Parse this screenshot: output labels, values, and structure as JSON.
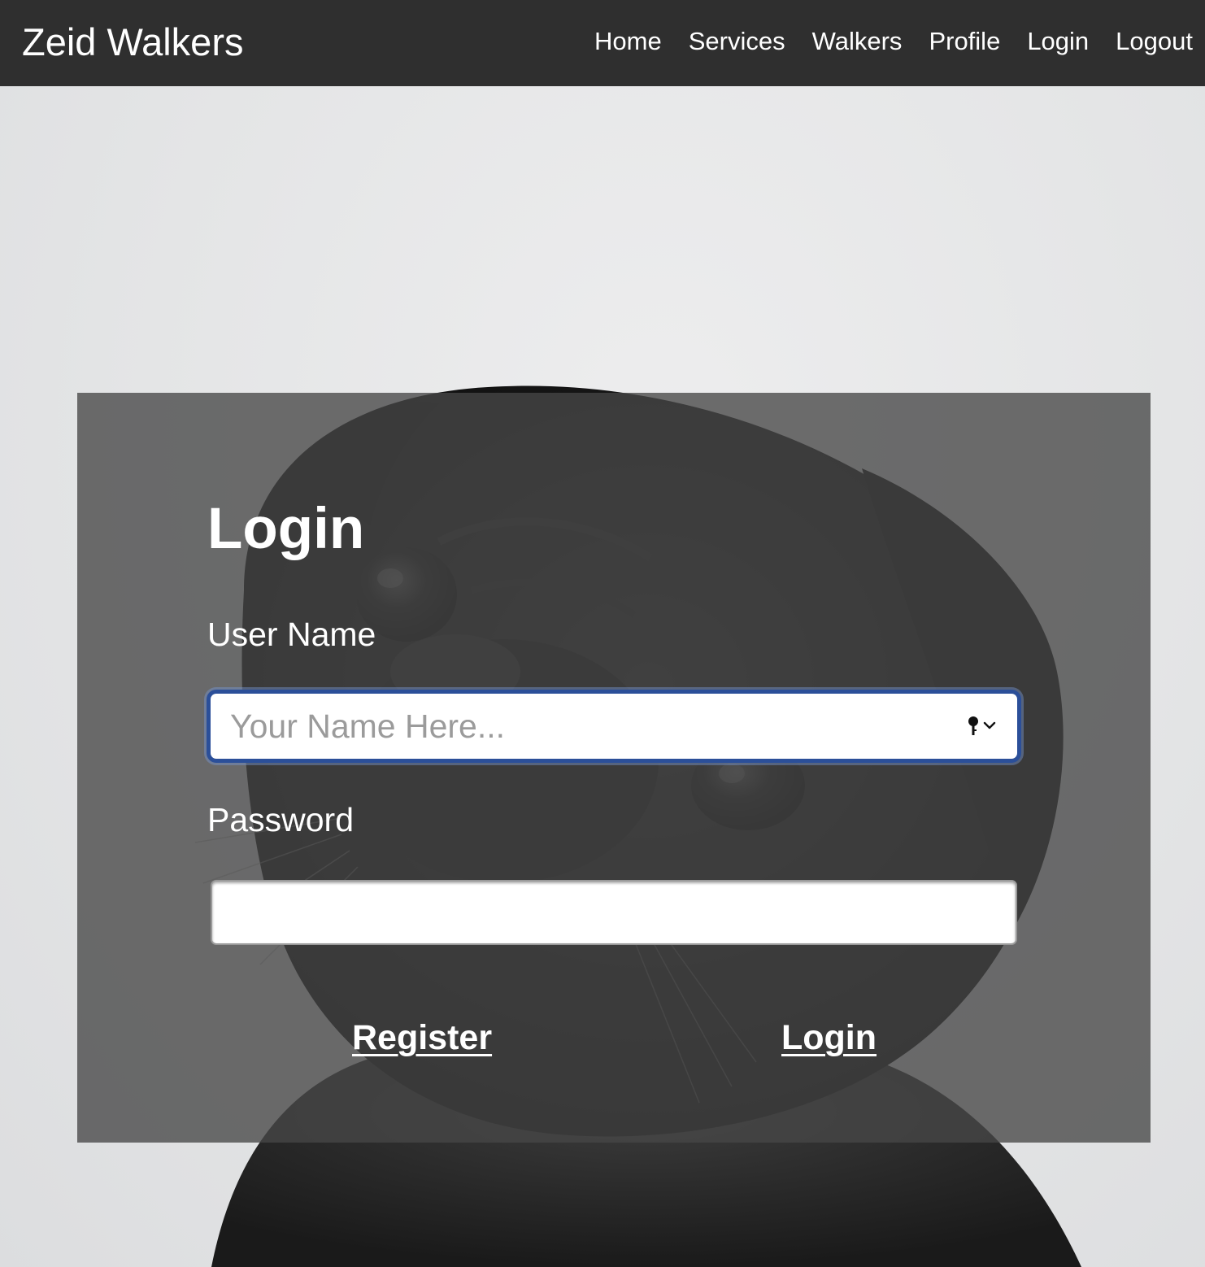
{
  "navbar": {
    "brand": "Zeid Walkers",
    "links": [
      "Home",
      "Services",
      "Walkers",
      "Profile",
      "Login",
      "Logout"
    ]
  },
  "background": {
    "subject": "black pug photo (grayscale)"
  },
  "login_form": {
    "title": "Login",
    "username": {
      "label": "User Name",
      "placeholder": "Your Name Here...",
      "value": "",
      "focused": true,
      "autofill_icon": "key-icon"
    },
    "password": {
      "label": "Password",
      "value": ""
    },
    "register_link": "Register",
    "login_link": "Login"
  },
  "colors": {
    "navbar_bg": "#2f2f2f",
    "card_overlay": "#464646",
    "focus_ring": "#2b4f99",
    "text": "#ffffff"
  }
}
